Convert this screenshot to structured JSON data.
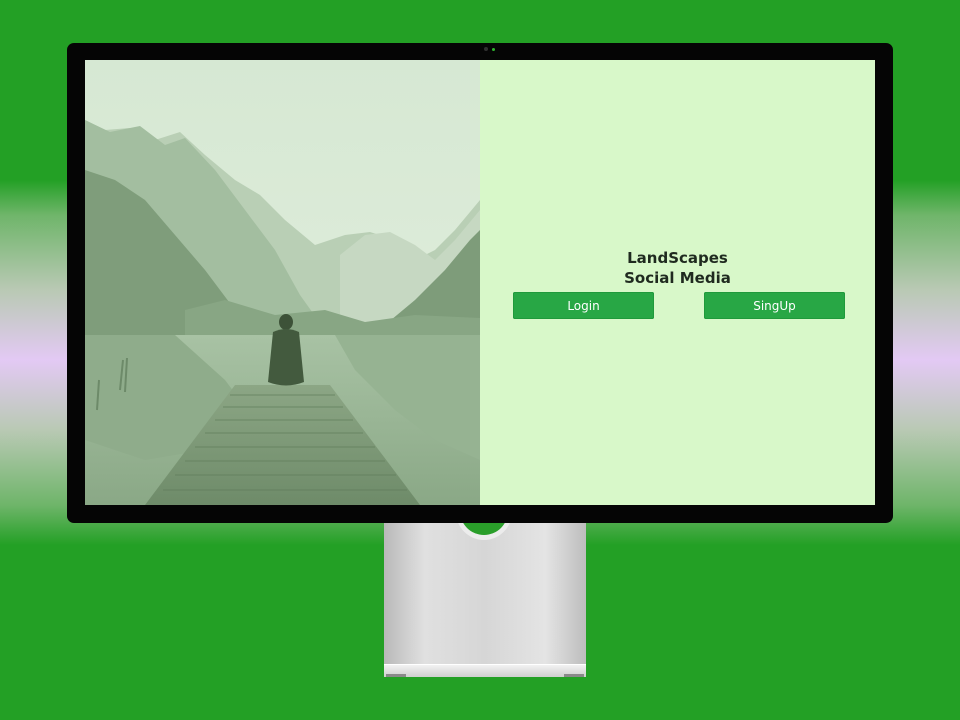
{
  "app": {
    "title_line1": "LandScapes",
    "title_line2": "Social Media"
  },
  "actions": {
    "login_label": "Login",
    "signup_label": "SingUp"
  },
  "colors": {
    "accent": "#28a745",
    "panel_background": "#d8f8c9",
    "page_background": "#23a025"
  },
  "hero_image": {
    "description_icon": "landscape-photo"
  }
}
